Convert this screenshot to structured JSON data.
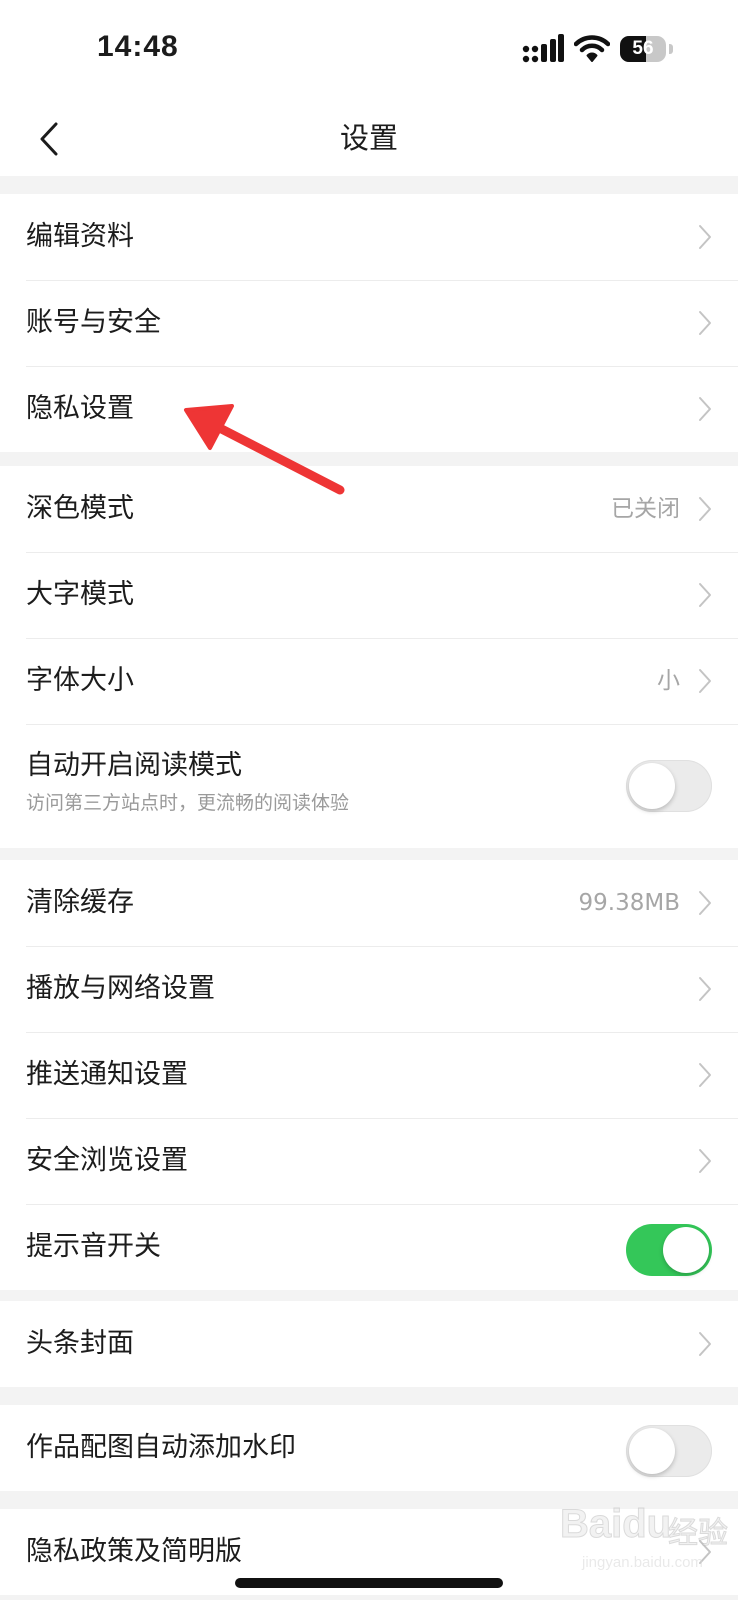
{
  "status_bar": {
    "time": "14:48",
    "battery_level": "56"
  },
  "nav": {
    "title": "设置"
  },
  "groups": [
    {
      "items": [
        {
          "label": "编辑资料"
        },
        {
          "label": "账号与安全"
        },
        {
          "label": "隐私设置"
        }
      ]
    },
    {
      "items": [
        {
          "label": "深色模式",
          "value": "已关闭"
        },
        {
          "label": "大字模式"
        },
        {
          "label": "字体大小",
          "value": "小"
        },
        {
          "label": "自动开启阅读模式",
          "sublabel": "访问第三方站点时，更流畅的阅读体验",
          "toggle": false
        }
      ]
    },
    {
      "items": [
        {
          "label": "清除缓存",
          "value": "99.38MB"
        },
        {
          "label": "播放与网络设置"
        },
        {
          "label": "推送通知设置"
        },
        {
          "label": "安全浏览设置"
        },
        {
          "label": "提示音开关",
          "toggle": true
        }
      ]
    },
    {
      "items": [
        {
          "label": "头条封面"
        }
      ]
    },
    {
      "items": [
        {
          "label": "作品配图自动添加水印",
          "toggle": false
        }
      ]
    },
    {
      "items": [
        {
          "label": "隐私政策及简明版"
        }
      ]
    }
  ],
  "colors": {
    "toggle_on": "#34c759",
    "annotation_arrow": "#ee3535",
    "page_background": "#f3f3f3"
  },
  "watermark": {
    "logo": "Baidu",
    "label": "经验",
    "url": "jingyan.baidu.com"
  }
}
